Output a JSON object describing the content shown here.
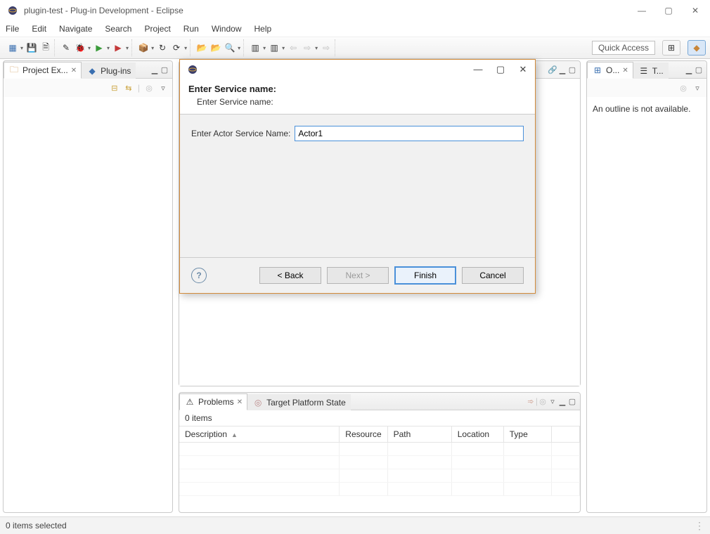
{
  "window": {
    "title": "plugin-test - Plug-in Development - Eclipse"
  },
  "menu": [
    "File",
    "Edit",
    "Navigate",
    "Search",
    "Project",
    "Run",
    "Window",
    "Help"
  ],
  "toolbar": {
    "quick_access": "Quick Access"
  },
  "left_view": {
    "tabs": [
      {
        "label": "Project Ex...",
        "active": true,
        "close": true
      },
      {
        "label": "Plug-ins",
        "active": false,
        "close": false
      }
    ]
  },
  "right_view": {
    "tabs": [
      {
        "label": "O...",
        "active": true,
        "close": true
      },
      {
        "label": "T...",
        "active": false,
        "close": false
      }
    ],
    "body_message": "An outline is not available."
  },
  "problems_view": {
    "tabs": [
      {
        "label": "Problems",
        "active": true,
        "close": true
      },
      {
        "label": "Target Platform State",
        "active": false,
        "close": false
      }
    ],
    "count_text": "0 items",
    "columns": [
      "Description",
      "Resource",
      "Path",
      "Location",
      "Type"
    ]
  },
  "status": {
    "text": "0 items selected"
  },
  "dialog": {
    "banner_title": "Enter Service name:",
    "banner_sub": "Enter Service name:",
    "field_label": "Enter Actor Service Name:",
    "field_value": "Actor1",
    "buttons": {
      "back": "< Back",
      "next": "Next >",
      "finish": "Finish",
      "cancel": "Cancel"
    }
  }
}
